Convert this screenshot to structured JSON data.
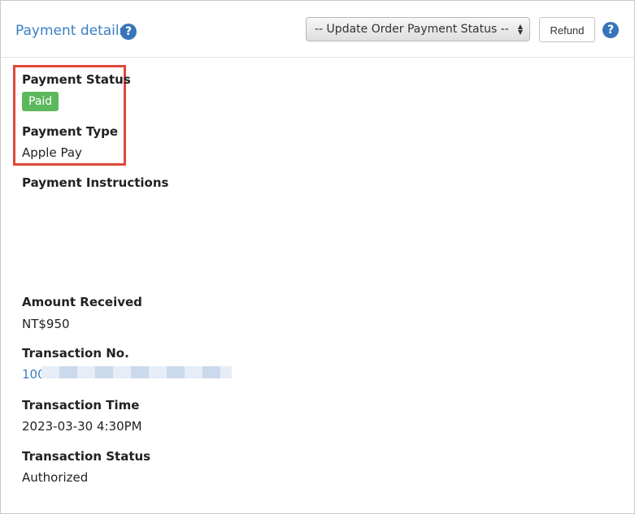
{
  "header": {
    "title": "Payment details",
    "status_select": "-- Update Order Payment Status --",
    "refund_label": "Refund"
  },
  "fields": {
    "payment_status_label": "Payment Status",
    "payment_status_value": "Paid",
    "payment_type_label": "Payment Type",
    "payment_type_value": "Apple Pay",
    "payment_instructions_label": "Payment Instructions",
    "amount_received_label": "Amount Received",
    "amount_received_value": "NT$950",
    "transaction_no_label": "Transaction No.",
    "transaction_no_value": "100",
    "transaction_time_label": "Transaction Time",
    "transaction_time_value": "2023-03-30 4:30PM",
    "transaction_status_label": "Transaction Status",
    "transaction_status_value": "Authorized"
  },
  "icons": {
    "help": "question-circle-icon",
    "select_arrows": "up-down-arrows-icon"
  },
  "colors": {
    "accent": "#3a7fc1",
    "help_icon": "#3774b8",
    "paid_badge": "#5cb85c",
    "highlight_border": "#e0483a"
  }
}
